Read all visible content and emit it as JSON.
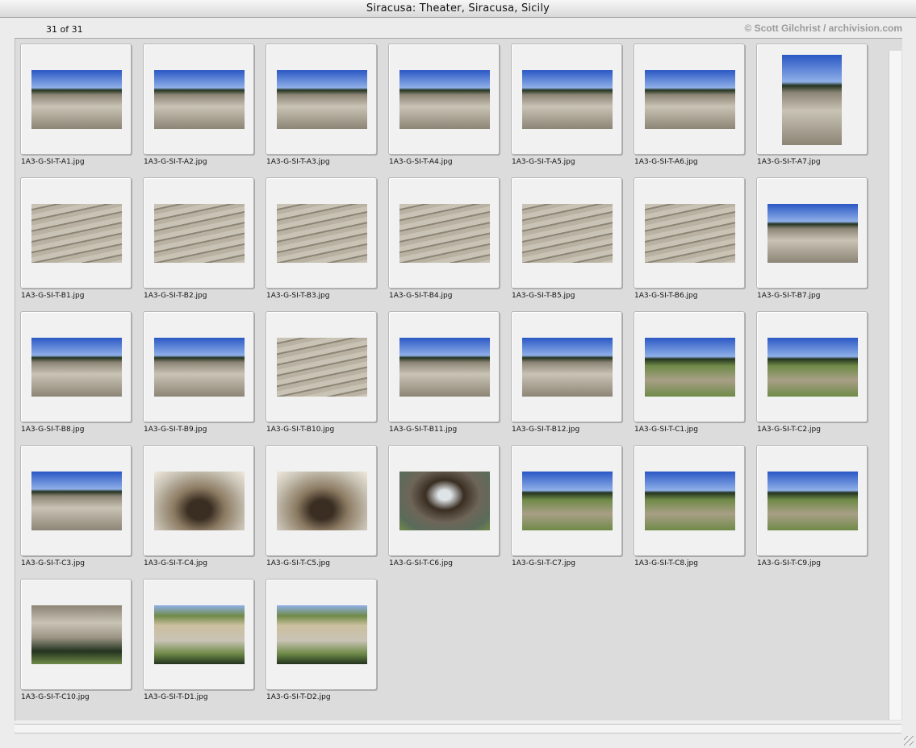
{
  "window": {
    "title": "Siracusa: Theater, Siracusa, Sicily"
  },
  "header": {
    "count": "31 of 31",
    "copyright": "© Scott Gilchrist / archivision.com"
  },
  "colors": {
    "sky": "#2a57c4",
    "sky_light": "#8fb0e8",
    "stone": "#c9c3b5",
    "stone_dark": "#8c8576",
    "grass": "#6f8a48",
    "tree": "#23331f",
    "cave": "#3a2e22",
    "water": "#5a6b5a"
  },
  "thumbnails": [
    {
      "file": "1A3-G-SI-T-A1.jpg",
      "orientation": "landscape",
      "scene": "sky"
    },
    {
      "file": "1A3-G-SI-T-A2.jpg",
      "orientation": "landscape",
      "scene": "sky"
    },
    {
      "file": "1A3-G-SI-T-A3.jpg",
      "orientation": "landscape",
      "scene": "sky"
    },
    {
      "file": "1A3-G-SI-T-A4.jpg",
      "orientation": "landscape",
      "scene": "sky"
    },
    {
      "file": "1A3-G-SI-T-A5.jpg",
      "orientation": "landscape",
      "scene": "sky"
    },
    {
      "file": "1A3-G-SI-T-A6.jpg",
      "orientation": "landscape",
      "scene": "sky"
    },
    {
      "file": "1A3-G-SI-T-A7.jpg",
      "orientation": "portrait",
      "scene": "sky"
    },
    {
      "file": "1A3-G-SI-T-B1.jpg",
      "orientation": "landscape",
      "scene": "stone"
    },
    {
      "file": "1A3-G-SI-T-B2.jpg",
      "orientation": "landscape",
      "scene": "stone"
    },
    {
      "file": "1A3-G-SI-T-B3.jpg",
      "orientation": "landscape",
      "scene": "stone"
    },
    {
      "file": "1A3-G-SI-T-B4.jpg",
      "orientation": "landscape",
      "scene": "stone"
    },
    {
      "file": "1A3-G-SI-T-B5.jpg",
      "orientation": "landscape",
      "scene": "stone"
    },
    {
      "file": "1A3-G-SI-T-B6.jpg",
      "orientation": "landscape",
      "scene": "stone"
    },
    {
      "file": "1A3-G-SI-T-B7.jpg",
      "orientation": "landscape",
      "scene": "sky"
    },
    {
      "file": "1A3-G-SI-T-B8.jpg",
      "orientation": "landscape",
      "scene": "sky"
    },
    {
      "file": "1A3-G-SI-T-B9.jpg",
      "orientation": "landscape",
      "scene": "sky"
    },
    {
      "file": "1A3-G-SI-T-B10.jpg",
      "orientation": "landscape",
      "scene": "stone"
    },
    {
      "file": "1A3-G-SI-T-B11.jpg",
      "orientation": "landscape",
      "scene": "sky"
    },
    {
      "file": "1A3-G-SI-T-B12.jpg",
      "orientation": "landscape",
      "scene": "sky"
    },
    {
      "file": "1A3-G-SI-T-C1.jpg",
      "orientation": "landscape",
      "scene": "field"
    },
    {
      "file": "1A3-G-SI-T-C2.jpg",
      "orientation": "landscape",
      "scene": "field"
    },
    {
      "file": "1A3-G-SI-T-C3.jpg",
      "orientation": "landscape",
      "scene": "sky"
    },
    {
      "file": "1A3-G-SI-T-C4.jpg",
      "orientation": "landscape",
      "scene": "cave"
    },
    {
      "file": "1A3-G-SI-T-C5.jpg",
      "orientation": "landscape",
      "scene": "cave"
    },
    {
      "file": "1A3-G-SI-T-C6.jpg",
      "orientation": "landscape",
      "scene": "water"
    },
    {
      "file": "1A3-G-SI-T-C7.jpg",
      "orientation": "landscape",
      "scene": "field"
    },
    {
      "file": "1A3-G-SI-T-C8.jpg",
      "orientation": "landscape",
      "scene": "field"
    },
    {
      "file": "1A3-G-SI-T-C9.jpg",
      "orientation": "landscape",
      "scene": "field"
    },
    {
      "file": "1A3-G-SI-T-C10.jpg",
      "orientation": "landscape",
      "scene": "cliff"
    },
    {
      "file": "1A3-G-SI-T-D1.jpg",
      "orientation": "landscape",
      "scene": "quarry"
    },
    {
      "file": "1A3-G-SI-T-D2.jpg",
      "orientation": "landscape",
      "scene": "quarry"
    }
  ]
}
